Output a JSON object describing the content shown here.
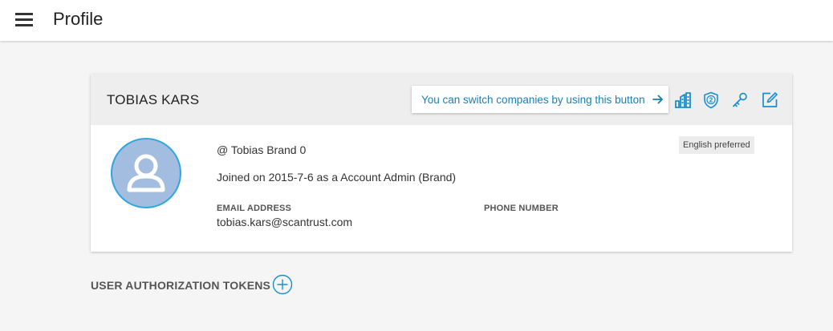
{
  "header": {
    "title": "Profile",
    "menu_icon": "hamburger-menu-icon"
  },
  "profile": {
    "name": "TOBIAS KARS",
    "switch_hint": "You can switch companies by using this button",
    "brand_line": "@ Tobias Brand 0",
    "joined_line": "Joined on 2015-7-6 as a Account Admin (Brand)",
    "language_badge": "English preferred",
    "email_label": "EMAIL ADDRESS",
    "email_value": "tobias.kars@scantrust.com",
    "phone_label": "PHONE NUMBER",
    "phone_value": "",
    "header_icons": [
      "company-buildings-icon",
      "two-factor-shield-icon",
      "key-icon",
      "edit-icon"
    ]
  },
  "tokens": {
    "title": "USER AUTHORIZATION TOKENS",
    "add_icon": "add-circle-icon"
  },
  "colors": {
    "accent": "#1a7fb5",
    "avatar_bg": "#a3bde0",
    "avatar_border": "#2fa6df",
    "page_bg": "#f5f5f5",
    "card_header_bg": "#eeeeee"
  }
}
